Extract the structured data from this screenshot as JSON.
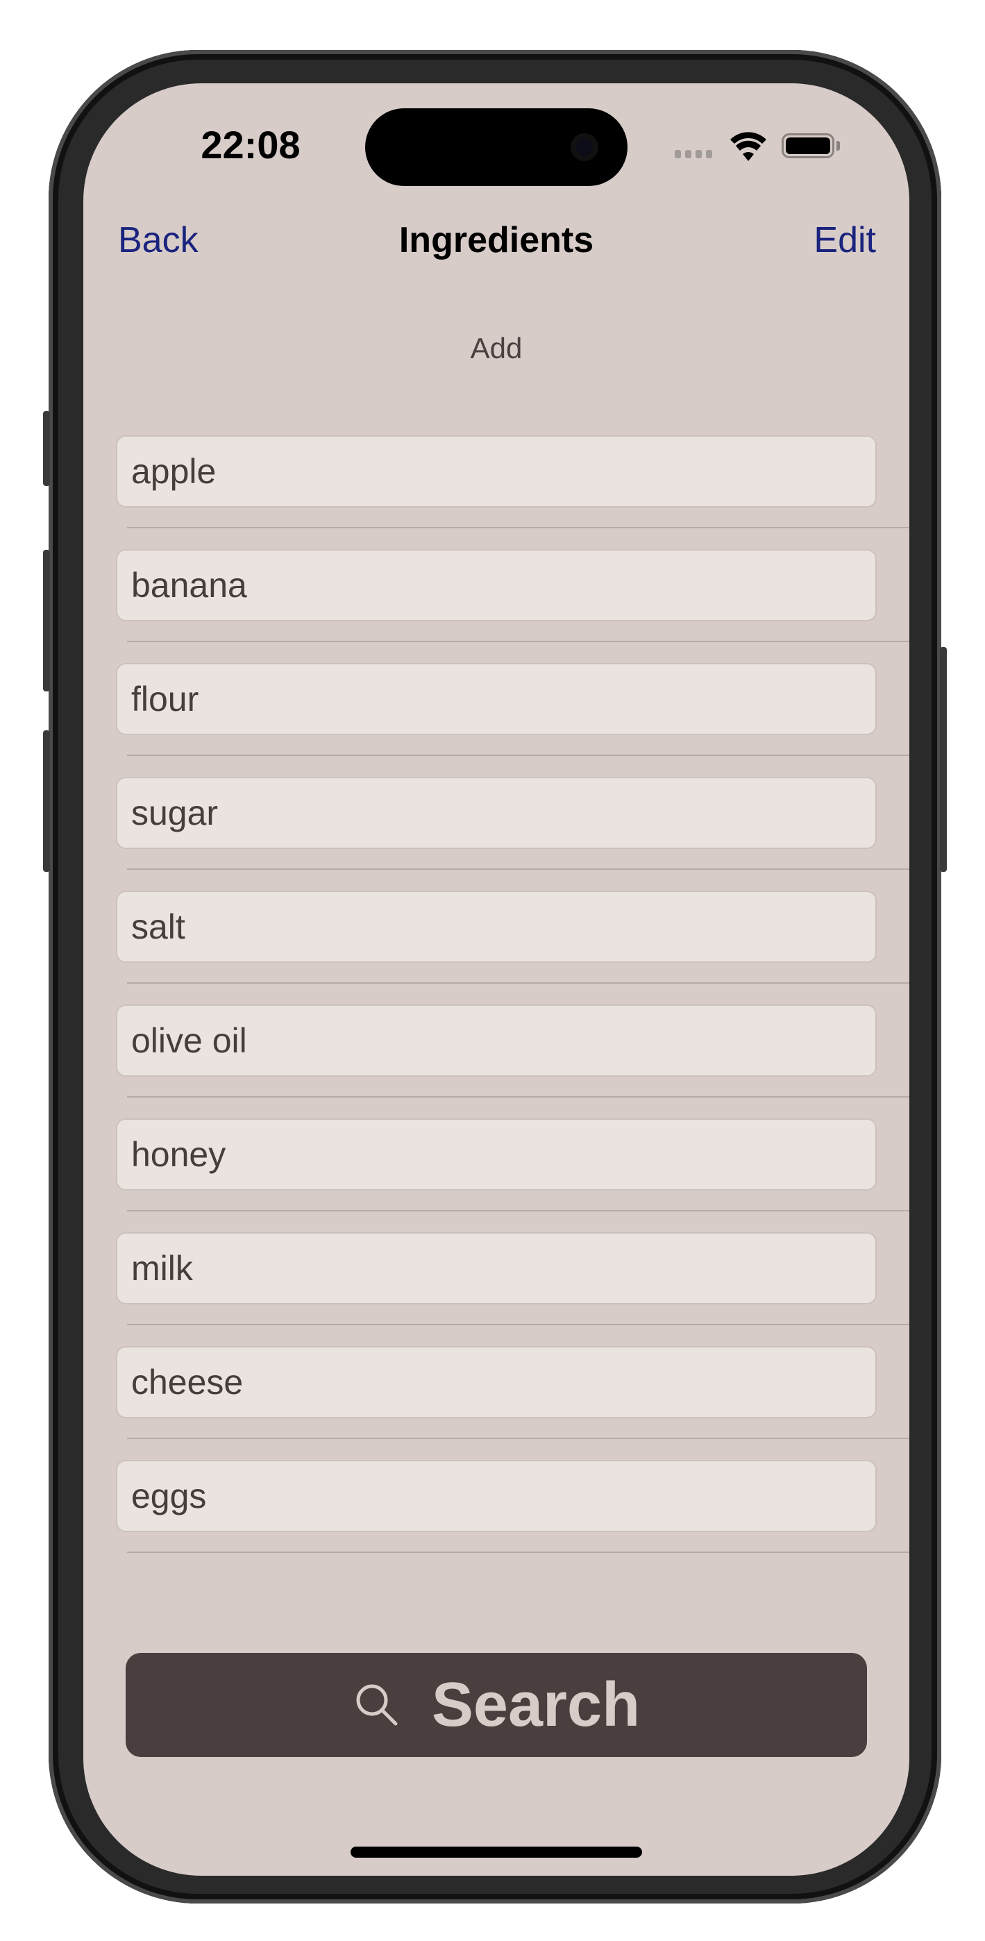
{
  "status_bar": {
    "time": "22:08",
    "icons": [
      "cellular-signal-icon",
      "wifi-icon",
      "battery-icon"
    ]
  },
  "nav_bar": {
    "back_label": "Back",
    "title": "Ingredients",
    "edit_label": "Edit"
  },
  "add_label": "Add",
  "ingredients": [
    {
      "value": "apple"
    },
    {
      "value": "banana"
    },
    {
      "value": "flour"
    },
    {
      "value": "sugar"
    },
    {
      "value": "salt"
    },
    {
      "value": "olive oil"
    },
    {
      "value": "honey"
    },
    {
      "value": "milk"
    },
    {
      "value": "cheese"
    },
    {
      "value": "eggs"
    }
  ],
  "search_button": {
    "label": "Search",
    "icon": "magnifying-glass-icon"
  },
  "colors": {
    "background": "#d7ccc8",
    "field_background": "#ebe3df",
    "accent_link": "#1a237e",
    "button_background": "#4a3f3e",
    "button_text": "#d7ccc8"
  }
}
